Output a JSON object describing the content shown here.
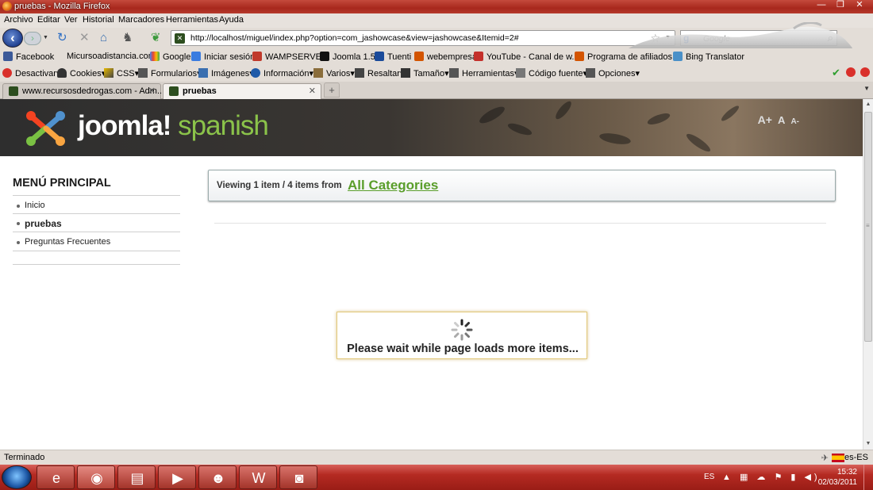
{
  "window": {
    "title": "pruebas - Mozilla Firefox",
    "minimize": "—",
    "maximize": "❐",
    "close": "✕"
  },
  "menubar": [
    "Archivo",
    "Editar",
    "Ver",
    "Historial",
    "Marcadores",
    "Herramientas",
    "Ayuda"
  ],
  "navbar": {
    "url": "http://localhost/miguel/index.php?option=com_jashowcase&view=jashowcase&Itemid=2#",
    "search_placeholder": "Google",
    "search_engine": "g"
  },
  "bookmarks": [
    "Facebook",
    "Micursoadistancia.com",
    "Google",
    "Iniciar sesión",
    "WAMPSERVER",
    "Joomla 1.5",
    "Tuenti",
    "webempresa",
    "YouTube - Canal de w...",
    "Programa de afiliados ...",
    "Bing Translator"
  ],
  "devbar": [
    "Desactivar▾",
    "Cookies▾",
    "CSS▾",
    "Formularios▾",
    "Imágenes▾",
    "Información▾",
    "Varios▾",
    "Resaltar▾",
    "Tamaño▾",
    "Herramientas▾",
    "Código fuente▾",
    "Opciones▾"
  ],
  "tabs": [
    {
      "label": "www.recursosdedrogas.com - Adm...",
      "close": "✕"
    },
    {
      "label": "pruebas",
      "close": "✕"
    }
  ],
  "new_tab": "+",
  "page": {
    "logo_main": "joomla!",
    "logo_sub": " spanish",
    "fontsize": [
      "A+",
      "A",
      "A-"
    ],
    "menu_title": "MENÚ PRINCIPAL",
    "menu_items": [
      "Inicio",
      "pruebas",
      "Preguntas Frecuentes"
    ],
    "viewing_text": "Viewing  1 item / 4 items   from",
    "viewing_link": "All Categories",
    "loading_message": "Please wait while page loads more items..."
  },
  "status": {
    "text": "Terminado",
    "locale": "es-ES"
  },
  "taskbar": {
    "lang": "ES",
    "time": "15:32",
    "date": "02/03/2011",
    "tray_icons": "▲ ▦ ☁ ⚑ ▮ ◀)"
  },
  "colors": {
    "accent_green": "#5a9e2b",
    "taskbar_red": "#b42a22",
    "header_dark": "#2e2e2e"
  }
}
